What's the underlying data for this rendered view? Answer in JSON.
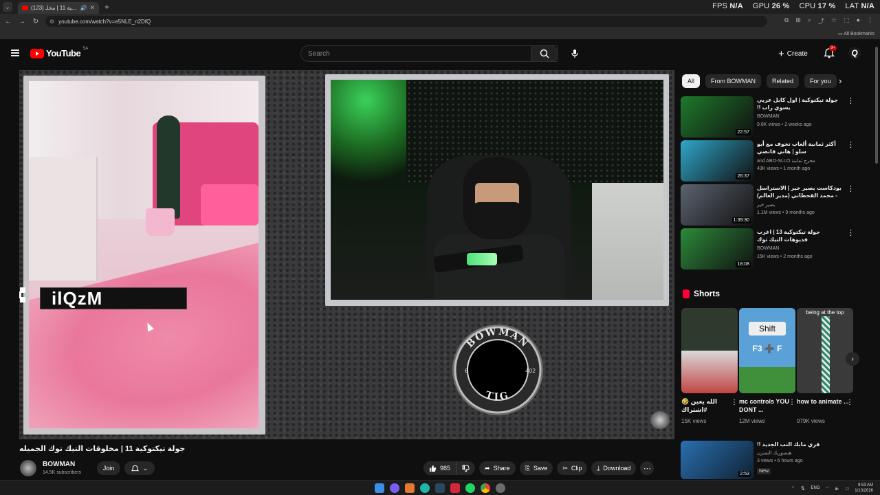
{
  "browser": {
    "tab_title": "(123) جولة تيكتوكية 11 | مخلـ...",
    "url": "youtube.com/watch?v=e5NLE_n2DfQ",
    "all_bookmarks": "All Bookmarks",
    "perf": {
      "fps_label": "FPS",
      "fps_value": "N/A",
      "gpu_label": "GPU",
      "gpu_value": "26 %",
      "cpu_label": "CPU",
      "cpu_value": "17 %",
      "lat_label": "LAT",
      "lat_value": "N/A"
    }
  },
  "youtube": {
    "logo_text": "YouTube",
    "country_code": "SA",
    "search_placeholder": "Search",
    "create_label": "Create",
    "notification_count": "9+",
    "avatar_letter": "Q"
  },
  "player": {
    "overlay_name": "ilQzM",
    "badge_top": "BOWMAN",
    "badge_bottom": "TIG",
    "badge_right": "402",
    "badge_left": "6"
  },
  "video": {
    "title": "جولة تيكتوكية 11 | مخلوقات التيك توك الجميله",
    "channel": "BOWMAN",
    "subscribers": "14.5K subscribers",
    "join_label": "Join",
    "like_count": "985",
    "share_label": "Share",
    "save_label": "Save",
    "clip_label": "Clip",
    "download_label": "Download"
  },
  "sidebar": {
    "chips": [
      "All",
      "From BOWMAN",
      "Related",
      "For you"
    ],
    "recommendations": [
      {
        "title": "جولة تيكتوكية | اول كابل عربي يسوي راب !!",
        "channel": "BOWMAN",
        "meta": "9.8K views • 2 weeks ago",
        "duration": "22:57",
        "color": "#1e7a2c"
      },
      {
        "title": "أكثر ثمانية ألعاب تخوف مع أبو سلو | هاني قانصي",
        "channel": "and ABO-SLLO مخرج ثمانية",
        "meta": "43K views • 1 month ago",
        "duration": "26:37",
        "color": "#2fa6c9"
      },
      {
        "title": "بودكاست بصير خير | الاستراسل - محمد القحطاني (مدير العالم)",
        "channel": "بصير خير",
        "meta": "1.1M views • 9 months ago",
        "duration": "1:39:30",
        "color": "#5c6470"
      },
      {
        "title": "جولة تيكتوكية 13 | اغرب فديوهات التيك توك",
        "channel": "BOWMAN",
        "meta": "15K views • 2 months ago",
        "duration": "18:08",
        "color": "#2c8a3a"
      }
    ],
    "shorts_title": "Shorts",
    "shorts": [
      {
        "title": "الله يعين 🤣 #اشتراك",
        "views": "15K views",
        "color": "#2f3a2f",
        "overlay": ""
      },
      {
        "title": "mc controls YOU DONT ...",
        "views": "12M views",
        "color": "#5aa1d8",
        "overlay": "Shift"
      },
      {
        "title": "how to animate ...",
        "views": "979K views",
        "color": "#3a3a3a",
        "overlay": "being at the top"
      }
    ],
    "shorts_keys": "F3 ➕ F",
    "bottom_reco": {
      "title": "قري مابك النب الجديد !!",
      "channel": "هنسوريك النمنرن",
      "meta": "3 views • 6 hours ago",
      "badge": "New",
      "duration": "2:53"
    }
  },
  "taskbar": {
    "lang": "ENG",
    "time": "9:53 AM",
    "date": "1/13/2026"
  }
}
